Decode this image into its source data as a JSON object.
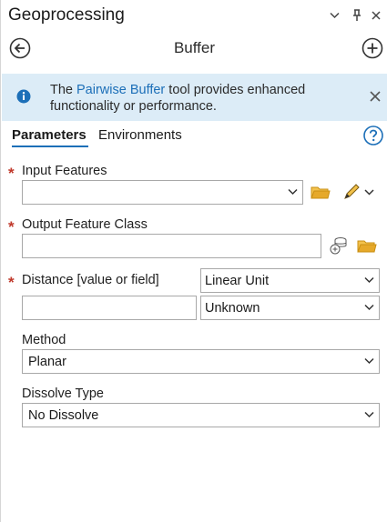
{
  "pane": {
    "title": "Geoprocessing"
  },
  "tool": {
    "name": "Buffer"
  },
  "banner": {
    "text_before": "The ",
    "link": "Pairwise Buffer",
    "text_after": " tool provides enhanced functionality or performance."
  },
  "tabs": {
    "parameters": "Parameters",
    "environments": "Environments"
  },
  "params": {
    "required_marker": "*",
    "input_features": {
      "label": "Input Features",
      "value": ""
    },
    "output_feature_class": {
      "label": "Output Feature Class",
      "value": ""
    },
    "distance": {
      "label": "Distance [value or field]",
      "value": "",
      "type_selected": "Linear Unit",
      "unit_selected": "Unknown"
    },
    "method": {
      "label": "Method",
      "selected": "Planar"
    },
    "dissolve_type": {
      "label": "Dissolve Type",
      "selected": "No Dissolve"
    }
  },
  "colors": {
    "accent": "#1c6fb8",
    "banner_bg": "#dcecf7",
    "required": "#c0392b",
    "folder": "#e0a82e"
  }
}
